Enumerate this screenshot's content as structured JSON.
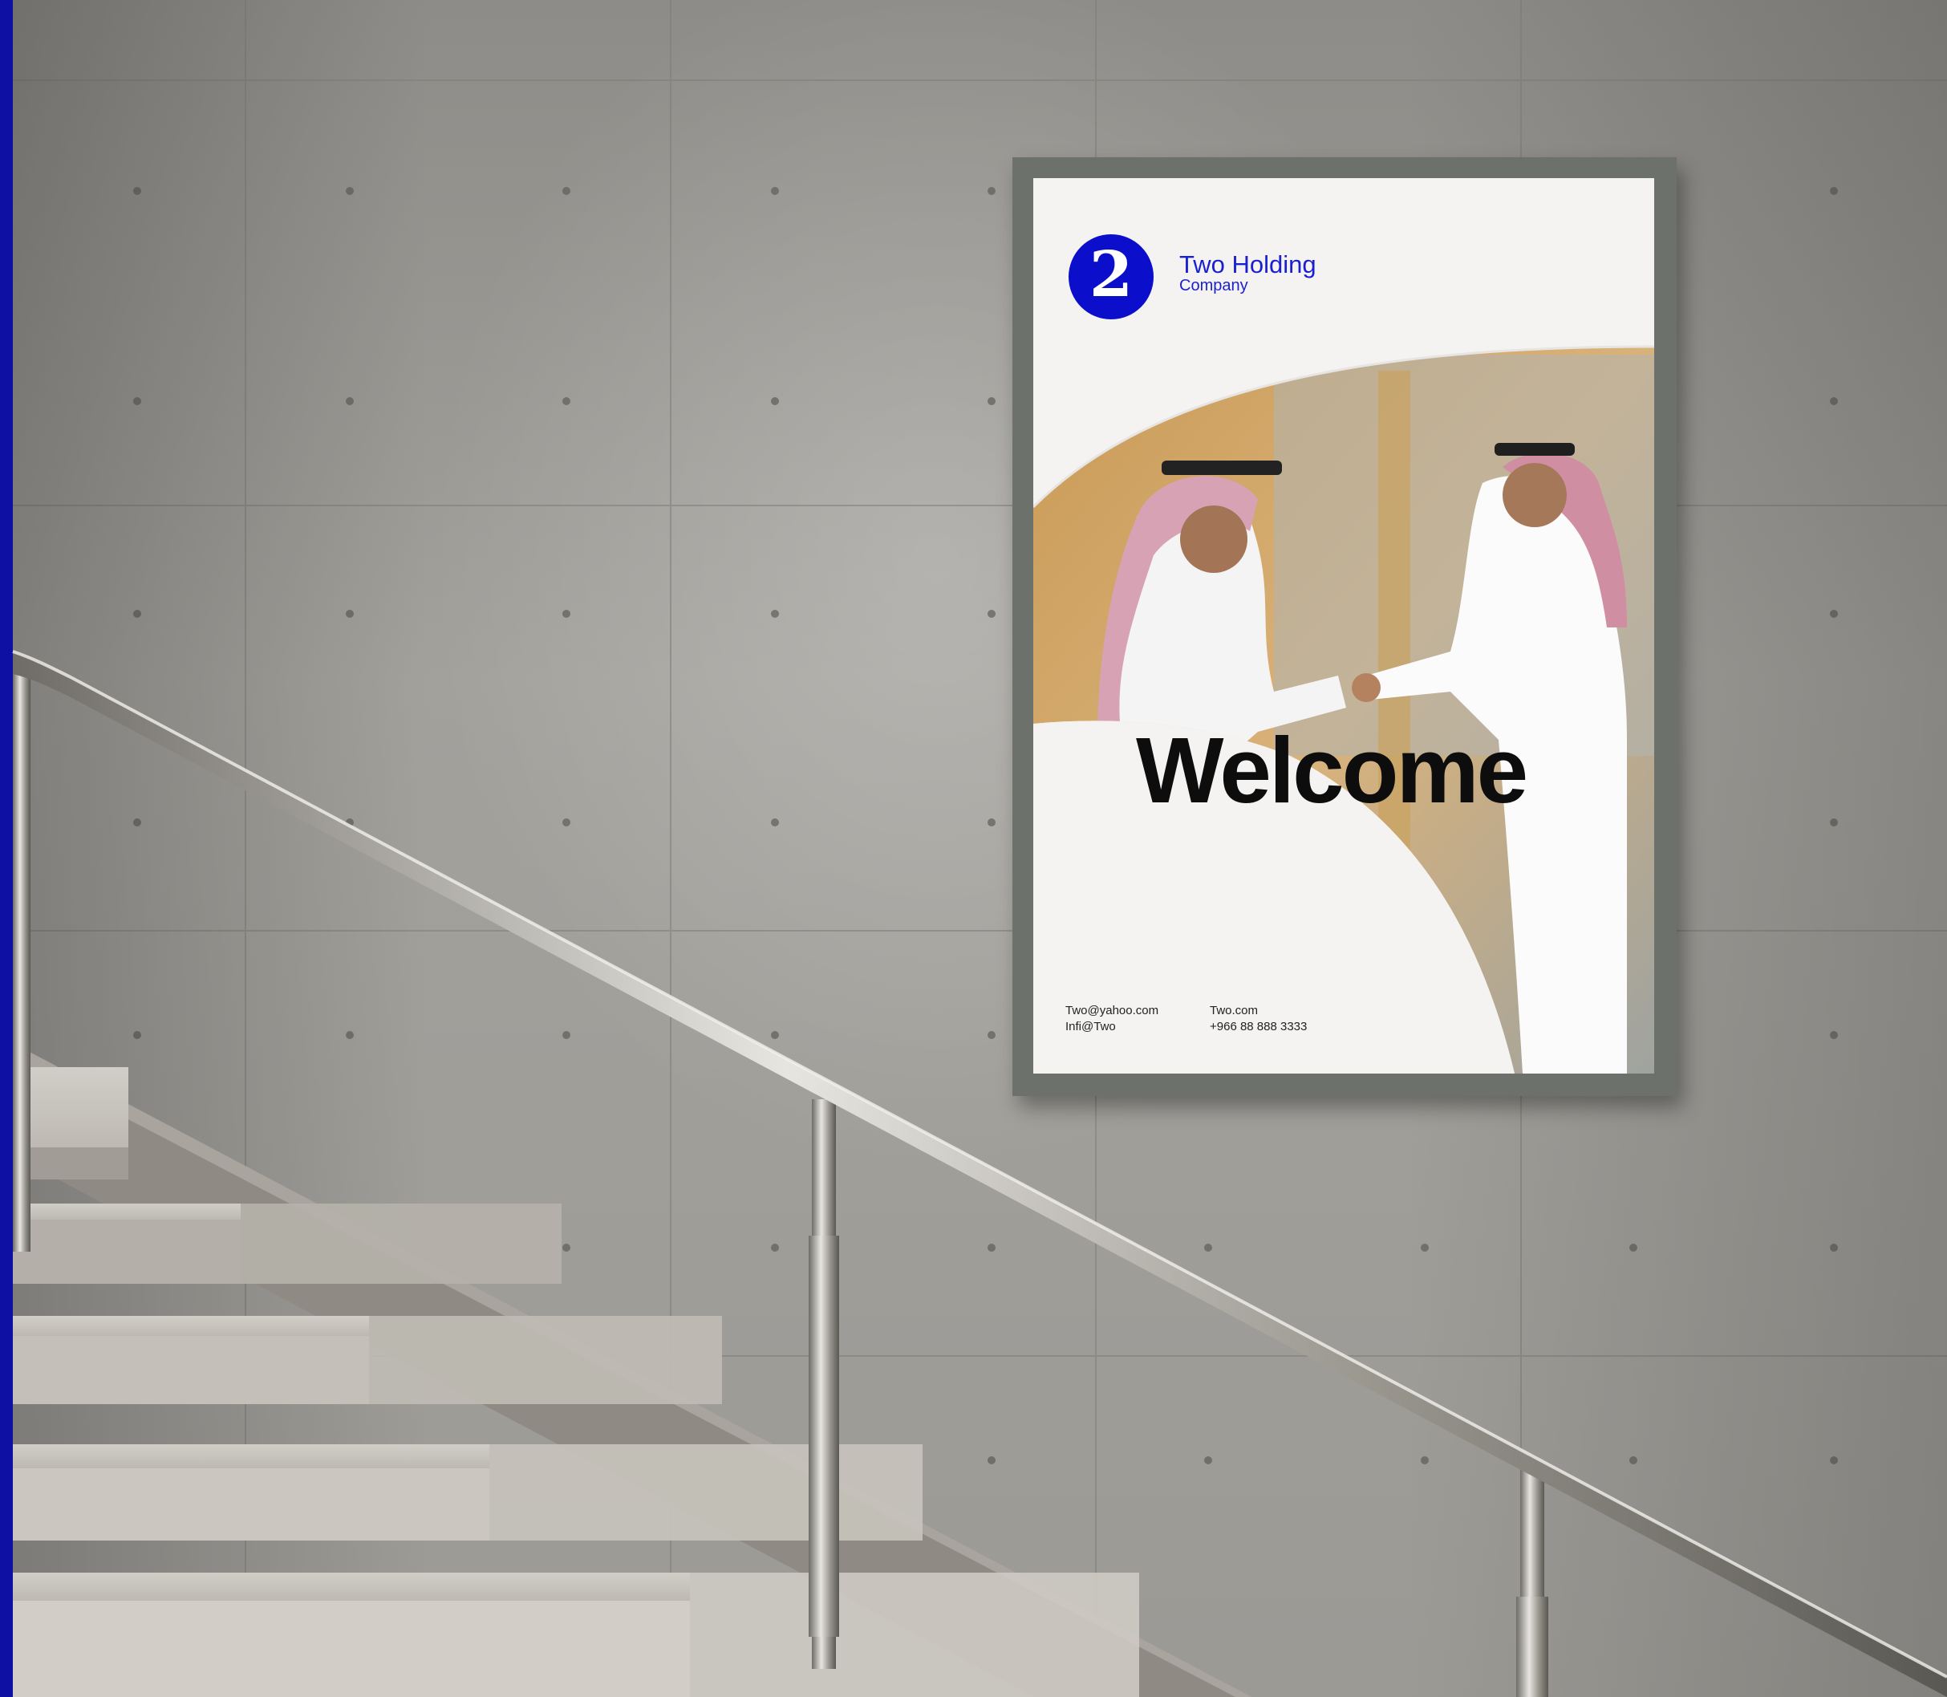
{
  "poster": {
    "brand_name": "Two Holding",
    "brand_sub": "Company",
    "logo_glyph": "2",
    "headline": "Welcome",
    "contact_left": [
      "Two@yahoo.com",
      "Infi@Two"
    ],
    "contact_right": [
      "Two.com",
      "+966 88 888 3333"
    ],
    "brand_color": "#0b0fcc"
  },
  "colors": {
    "edge_bar": "#0e10a3",
    "wall": "#9c9a95",
    "frame": "#6c716b"
  }
}
